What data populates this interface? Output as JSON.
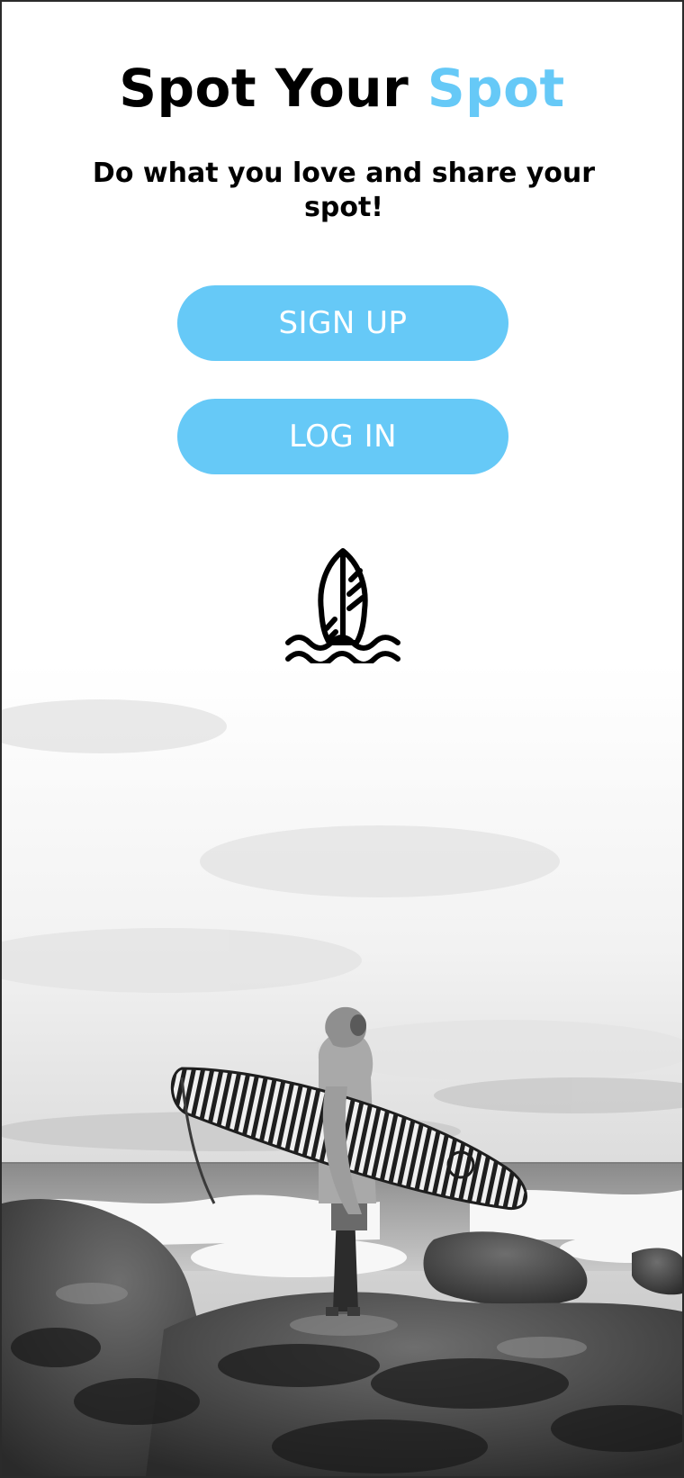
{
  "header": {
    "title_part1": "Spot Your ",
    "title_accent": "Spot",
    "subtitle": "Do what you love and share your spot!"
  },
  "actions": {
    "signup_label": "SIGN UP",
    "login_label": "LOG IN"
  },
  "icons": {
    "logo": "surfboard-waves-icon"
  },
  "colors": {
    "accent": "#66c9f7",
    "text": "#000000",
    "button_text": "#ffffff"
  }
}
